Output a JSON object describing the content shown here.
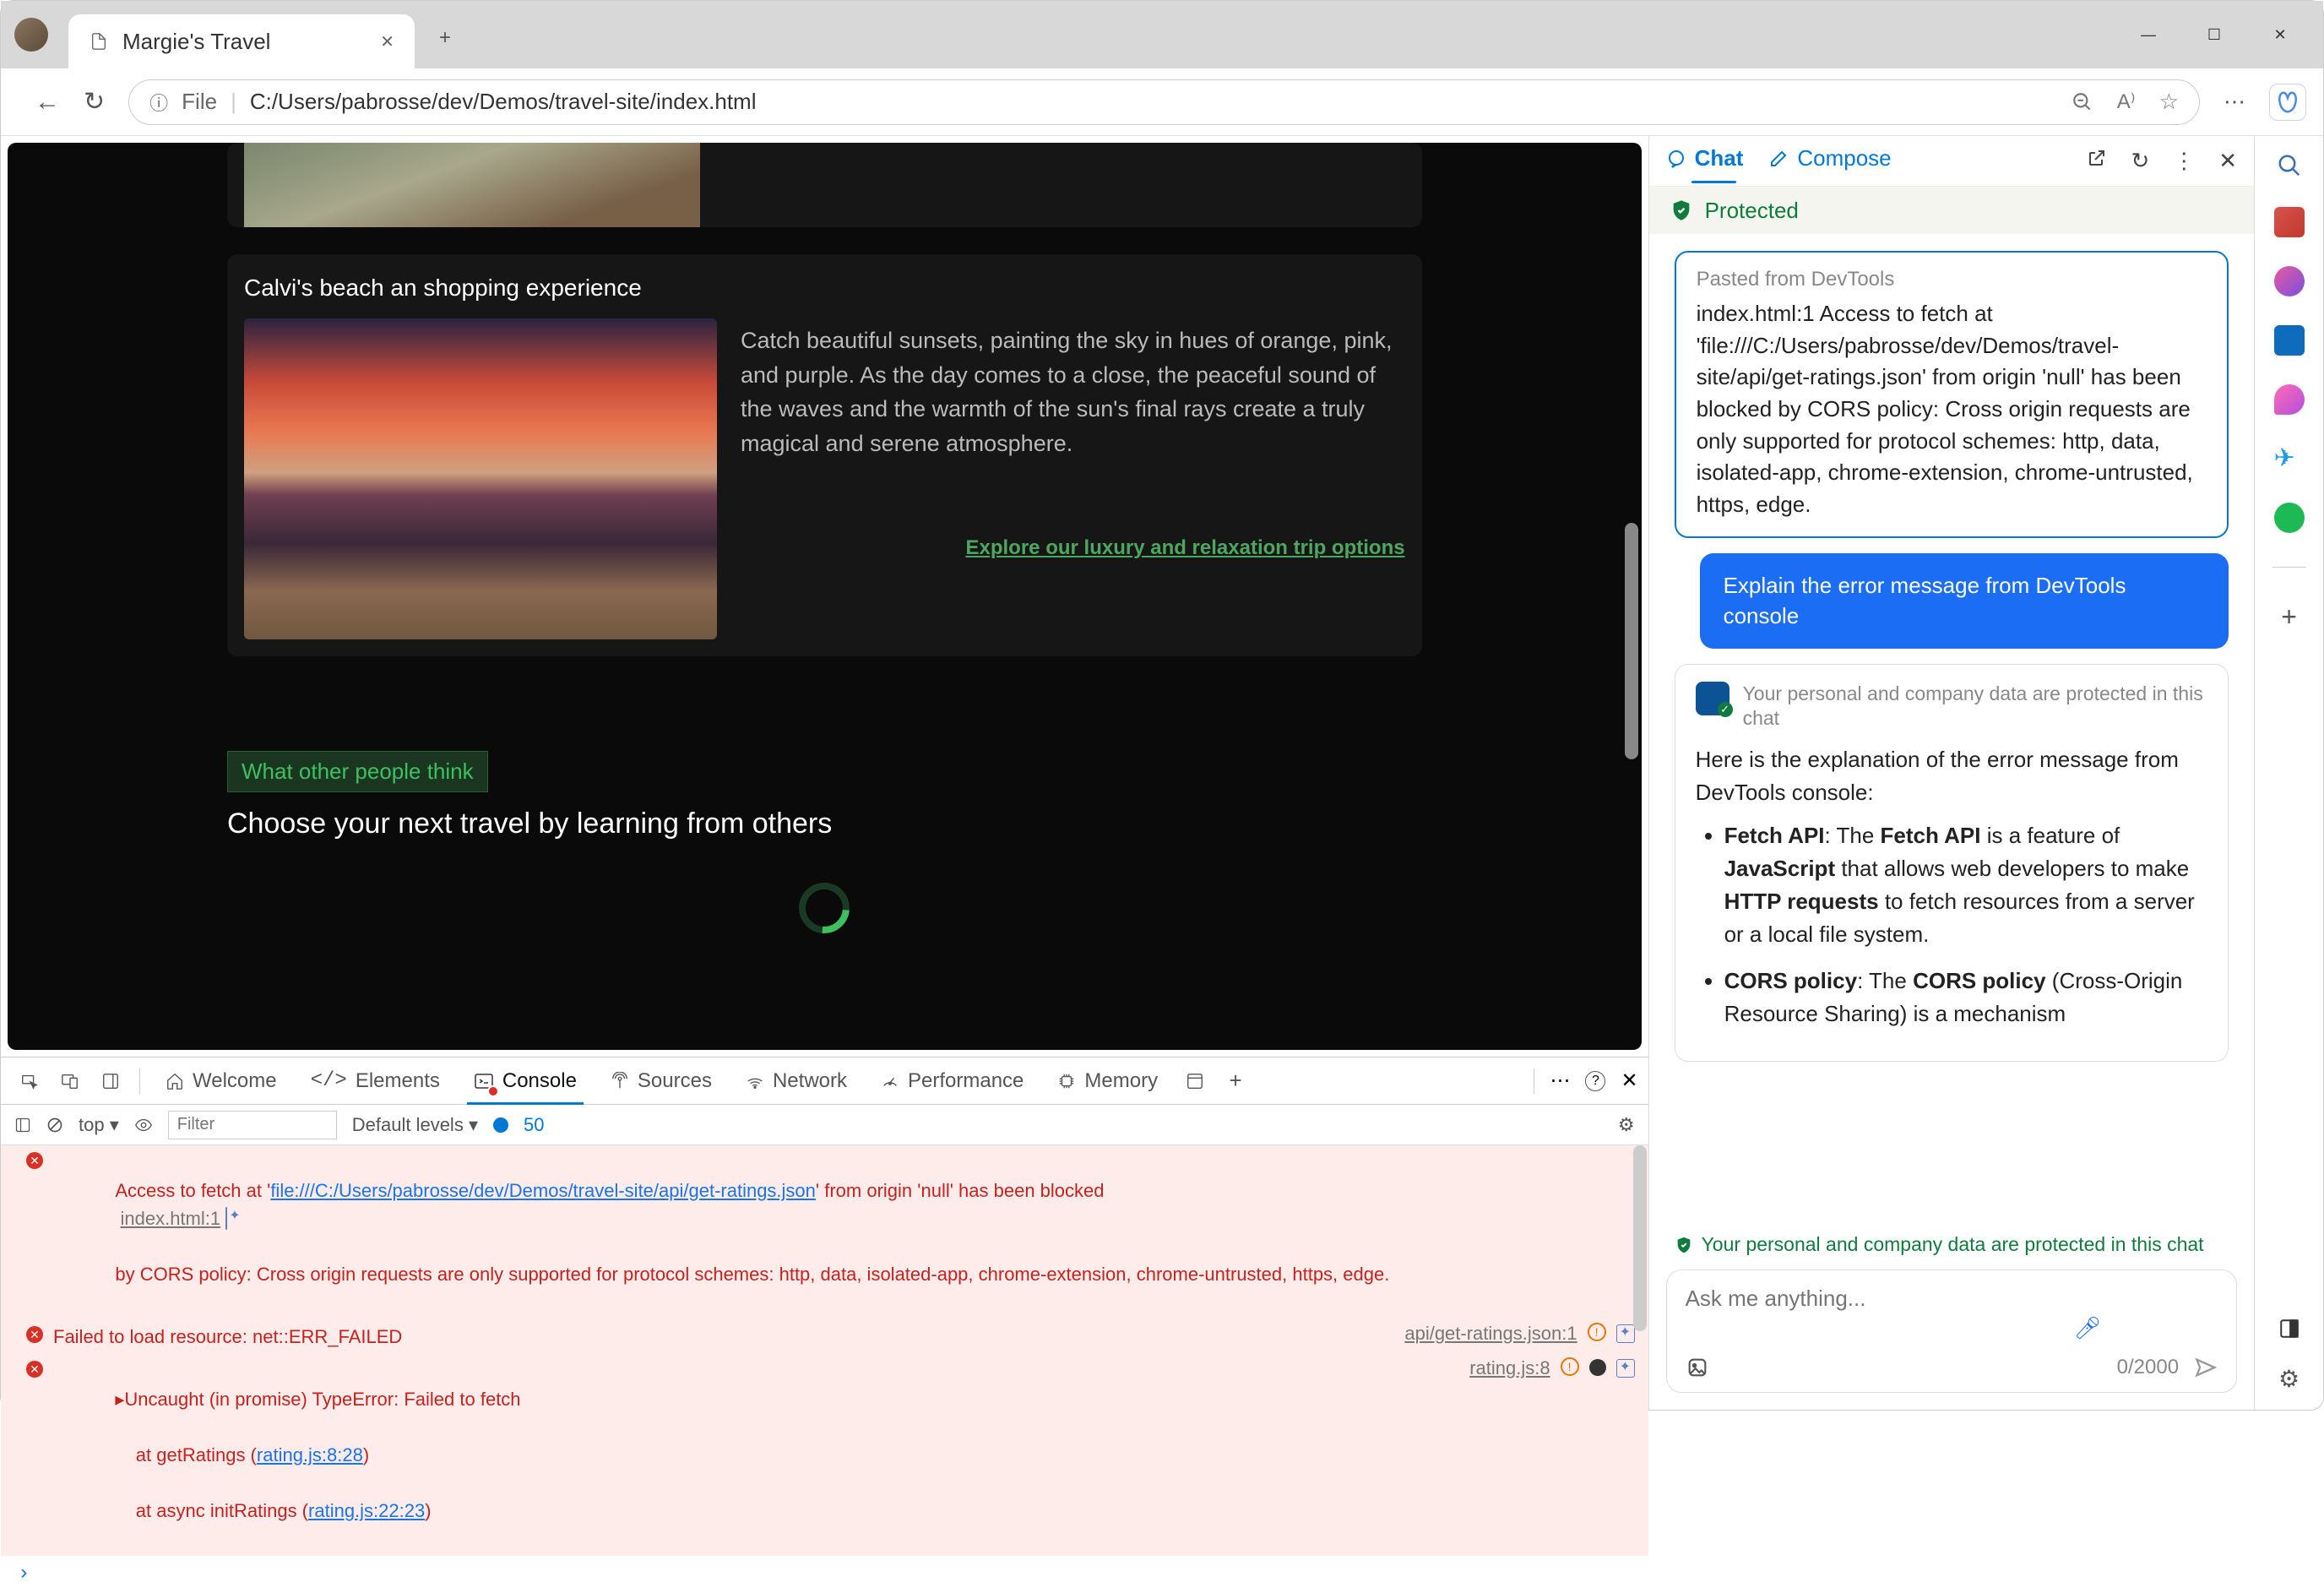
{
  "titlebar": {
    "tab_title": "Margie's Travel"
  },
  "addressbar": {
    "scheme_label": "File",
    "url": "C:/Users/pabrosse/dev/Demos/travel-site/index.html"
  },
  "page": {
    "card_title": "Calvi's beach an shopping experience",
    "card_text": "Catch beautiful sunsets, painting the sky in hues of orange, pink, and purple. As the day comes to a close, the peaceful sound of the waves and the warmth of the sun's final rays create a truly magical and serene atmosphere.",
    "card_link": "Explore our luxury and relaxation trip options",
    "badge": "What other people think",
    "subhead": "Choose your next travel by learning from others"
  },
  "devtools": {
    "tabs": {
      "welcome": "Welcome",
      "elements": "Elements",
      "console": "Console",
      "sources": "Sources",
      "network": "Network",
      "performance": "Performance",
      "memory": "Memory"
    },
    "filter": {
      "top": "top",
      "placeholder": "Filter",
      "levels": "Default levels",
      "count": "50"
    },
    "settings_icon": "⚙",
    "log": {
      "l1_pre": "Access to fetch at '",
      "l1_url": "file:///C:/Users/pabrosse/dev/Demos/travel-site/api/get-ratings.json",
      "l1_mid": "' from origin 'null' has been blocked",
      "l1_src": "index.html:1",
      "l1_rest": "by CORS policy: Cross origin requests are only supported for protocol schemes: http, data, isolated-app, chrome-extension, chrome-untrusted, https, edge.",
      "l2": "Failed to load resource: net::ERR_FAILED",
      "l2_src": "api/get-ratings.json:1",
      "l3a": "▸Uncaught (in promise) TypeError: Failed to fetch",
      "l3b": "    at getRatings (",
      "l3b_link": "rating.js:8:28",
      "l3c": "    at async initRatings (",
      "l3c_link": "rating.js:22:23",
      "l3_src": "rating.js:8"
    }
  },
  "copilot": {
    "tabs": {
      "chat": "Chat",
      "compose": "Compose"
    },
    "protected": "Protected",
    "paste_label": "Pasted from DevTools",
    "paste_content": "index.html:1 Access to fetch at 'file:///C:/Users/pabrosse/dev/Demos/travel-site/api/get-ratings.json' from origin 'null' has been blocked by CORS policy: Cross origin requests are only supported for protocol schemes: http, data, isolated-app, chrome-extension, chrome-untrusted, https, edge.",
    "user_msg": "Explain the error message from DevTools console",
    "resp_note": "Your personal and company data are protected in this chat",
    "resp_intro": "Here is the explanation of the error message from DevTools console:",
    "bullet1_a": "Fetch API",
    "bullet1_b": ": The ",
    "bullet1_c": "Fetch API",
    "bullet1_d": " is a feature of ",
    "bullet1_e": "JavaScript",
    "bullet1_f": " that allows web developers to make ",
    "bullet1_g": "HTTP requests",
    "bullet1_h": " to fetch resources from a server or a local file system.",
    "bullet2_a": "CORS policy",
    "bullet2_b": ": The ",
    "bullet2_c": "CORS policy",
    "bullet2_d": " (Cross-Origin Resource Sharing) is a mechanism",
    "footer_note": "Your personal and company data are protected in this chat",
    "input_placeholder": "Ask me anything...",
    "char_count": "0/2000"
  }
}
